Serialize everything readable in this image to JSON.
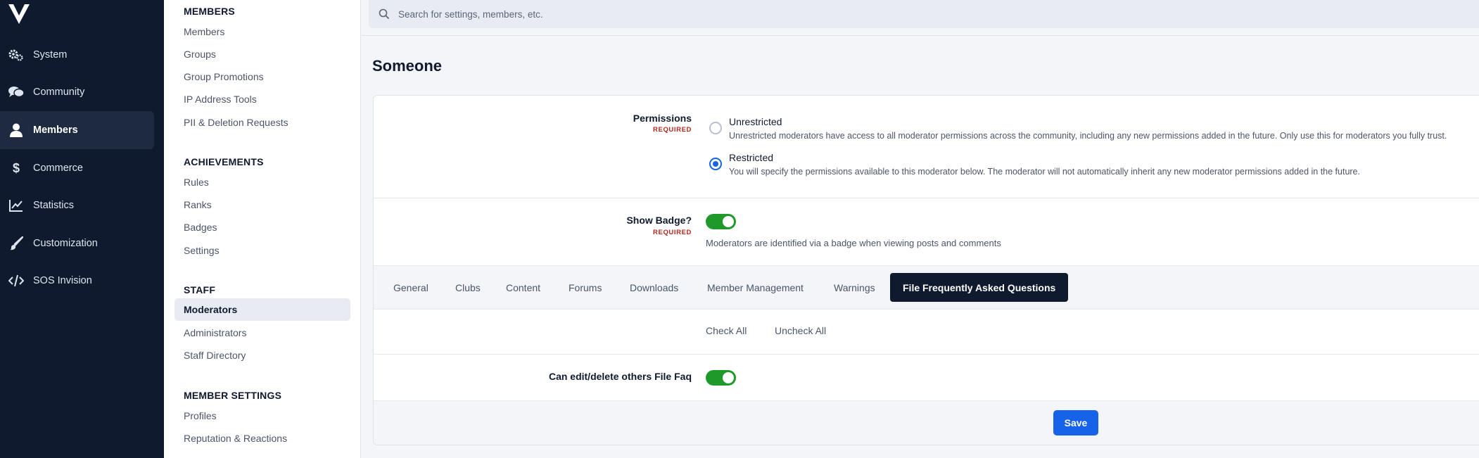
{
  "primary_nav": {
    "items": [
      {
        "label": "System",
        "icon": "gears-icon"
      },
      {
        "label": "Community",
        "icon": "comments-icon"
      },
      {
        "label": "Members",
        "icon": "user-icon",
        "active": true
      },
      {
        "label": "Commerce",
        "icon": "dollar-icon"
      },
      {
        "label": "Statistics",
        "icon": "chart-line-icon"
      },
      {
        "label": "Customization",
        "icon": "paintbrush-icon"
      },
      {
        "label": "SOS Invision",
        "icon": "code-icon"
      }
    ]
  },
  "secondary_nav": {
    "sections": [
      {
        "heading": "MEMBERS",
        "items": [
          "Members",
          "Groups",
          "Group Promotions",
          "IP Address Tools",
          "PII & Deletion Requests"
        ]
      },
      {
        "heading": "ACHIEVEMENTS",
        "items": [
          "Rules",
          "Ranks",
          "Badges",
          "Settings"
        ]
      },
      {
        "heading": "STAFF",
        "items": [
          "Moderators",
          "Administrators",
          "Staff Directory"
        ]
      },
      {
        "heading": "MEMBER SETTINGS",
        "items": [
          "Profiles",
          "Reputation & Reactions"
        ]
      }
    ],
    "active_item": "Moderators"
  },
  "search": {
    "placeholder": "Search for settings, members, etc."
  },
  "page": {
    "title": "Someone"
  },
  "form": {
    "permissions": {
      "label": "Permissions",
      "required": "REQUIRED",
      "options": [
        {
          "title": "Unrestricted",
          "description": "Unrestricted moderators have access to all moderator permissions across the community, including any new permissions added in the future. Only use this for moderators you fully trust.",
          "checked": false
        },
        {
          "title": "Restricted",
          "description": "You will specify the permissions available to this moderator below. The moderator will not automatically inherit any new moderator permissions added in the future.",
          "checked": true
        }
      ]
    },
    "show_badge": {
      "label": "Show Badge?",
      "required": "REQUIRED",
      "enabled": true,
      "description": "Moderators are identified via a badge when viewing posts and comments"
    },
    "tabs": [
      "General",
      "Clubs",
      "Content",
      "Forums",
      "Downloads",
      "Member Management",
      "Warnings",
      "File Frequently Asked Questions"
    ],
    "active_tab": "File Frequently Asked Questions",
    "check_all": "Check All",
    "uncheck_all": "Uncheck All",
    "file_faq": {
      "label": "Can edit/delete others File Faq",
      "enabled": true
    },
    "save": "Save"
  },
  "colors": {
    "nav_bg": "#0f1a2e",
    "accent": "#1662e8",
    "toggle_on": "#1f9a2a",
    "required": "#b3261e"
  }
}
